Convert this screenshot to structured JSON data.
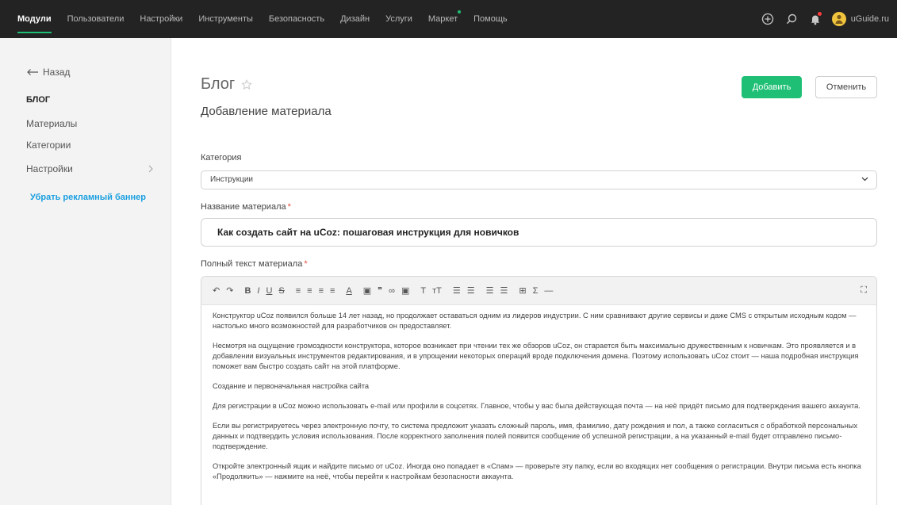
{
  "nav": {
    "items": [
      {
        "label": "Модули",
        "active": true
      },
      {
        "label": "Пользователи"
      },
      {
        "label": "Настройки"
      },
      {
        "label": "Инструменты"
      },
      {
        "label": "Безопасность"
      },
      {
        "label": "Дизайн"
      },
      {
        "label": "Услуги"
      },
      {
        "label": "Маркет",
        "dot": true
      },
      {
        "label": "Помощь"
      }
    ],
    "site": "uGuide.ru",
    "icons": [
      "plus-circle-icon",
      "search-icon",
      "bell-icon",
      "avatar"
    ]
  },
  "sidebar": {
    "back_label": "Назад",
    "heading": "БЛОГ",
    "links": [
      "Материалы",
      "Категории",
      "Настройки"
    ],
    "promo": "Убрать рекламный баннер"
  },
  "page": {
    "title": "Блог",
    "subtitle": "Добавление материала",
    "add_button": "Добавить",
    "cancel_button": "Отменить"
  },
  "form": {
    "category_label": "Категория",
    "category_value": "Инструкции",
    "name_label": "Название материала",
    "name_value": "Как создать сайт на uCoz: пошаговая инструкция для новичков",
    "text_label": "Полный текст материала",
    "required_mark": "*"
  },
  "editor": {
    "toolbar": {
      "undo": "↶",
      "redo": "↷",
      "bold": "B",
      "italic": "I",
      "underline": "U",
      "strike": "S",
      "align_left": "≡",
      "align_center": "≡",
      "align_right": "≡",
      "align_justify": "≡",
      "font_color": "A",
      "image": "▣",
      "quote": "❞",
      "link": "∞",
      "media": "▣",
      "font": "T",
      "font_size": "тT",
      "list_ol": "☰",
      "list_ul": "☰",
      "indent": "☰",
      "outdent": "☰",
      "table": "⊞",
      "formula": "Σ",
      "hr": "—",
      "fullscreen": "⛶"
    },
    "paragraphs": [
      "Конструктор uCoz появился больше 14 лет назад, но продолжает оставаться одним из лидеров индустрии. С ним сравнивают другие сервисы и даже CMS с открытым исходным кодом — настолько много возможностей для разработчиков он предоставляет.",
      "Несмотря на ощущение громоздкости конструктора, которое возникает при чтении тех же обзоров uCoz, он старается быть максимально дружественным к новичкам. Это проявляется и в добавлении визуальных инструментов редактирования, и в упрощении некоторых операций вроде подключения домена. Поэтому использовать uCoz стоит — наша подробная инструкция поможет вам быстро создать сайт на этой платформе.",
      "Создание и первоначальная настройка сайта",
      "Для регистрации в uCoz можно использовать e-mail или профили в соцсетях. Главное, чтобы у вас была действующая почта — на неё придёт письмо для подтверждения вашего аккаунта.",
      "Если вы регистрируетесь через электронную почту, то система предложит указать сложный пароль, имя, фамилию, дату рождения и пол, а также согласиться с обработкой персональных данных и подтвердить условия использования. После корректного заполнения полей появится сообщение об успешной регистрации, а на указанный e-mail будет отправлено письмо-подтверждение.",
      "Откройте электронный ящик и найдите письмо от uCoz. Иногда оно попадает в «Спам» — проверьте эту папку, если во входящих нет сообщения о регистрации. Внутри письма есть кнопка «Продолжить» — нажмите на неё, чтобы перейти к настройкам безопасности аккаунта."
    ]
  },
  "colors": {
    "topbar": "#232323",
    "accent": "#1fbf75",
    "link": "#1a9fe0",
    "required": "#e74c3c"
  }
}
